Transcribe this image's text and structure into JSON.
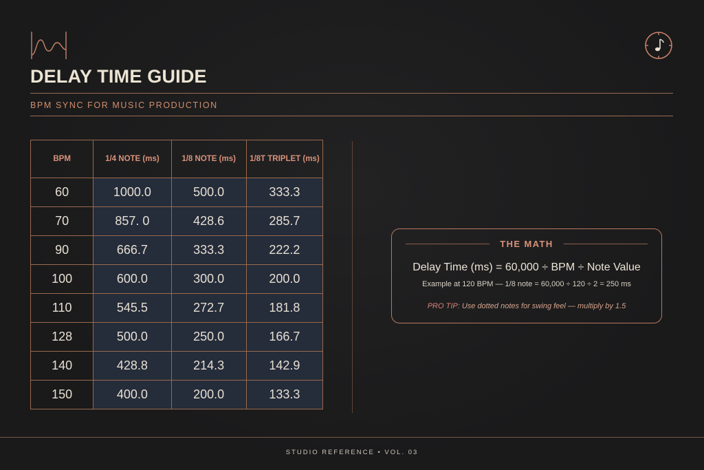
{
  "header": {
    "title": "DELAY TIME GUIDE",
    "subtitle": "BPM SYNC FOR MUSIC PRODUCTION"
  },
  "icons": {
    "logo": "waveform-logo-icon",
    "corner": "clock-music-note-icon"
  },
  "table": {
    "headers": [
      "BPM",
      "1/4 NOTE (ms)",
      "1/8 NOTE (ms)",
      "1/8T TRIPLET (ms)"
    ],
    "rows": [
      [
        "60",
        "1000.0",
        "500.0",
        "333.3"
      ],
      [
        "70",
        "857. 0",
        "428.6",
        "285.7"
      ],
      [
        "90",
        "666.7",
        "333.3",
        "222.2"
      ],
      [
        "100",
        "600.0",
        "300.0",
        "200.0"
      ],
      [
        "110",
        "545.5",
        "272.7",
        "181.8"
      ],
      [
        "128",
        "500.0",
        "250.0",
        "166.7"
      ],
      [
        "140",
        "428.8",
        "214.3",
        "142.9"
      ],
      [
        "150",
        "400.0",
        "200.0",
        "133.3"
      ]
    ]
  },
  "math": {
    "heading": "THE MATH",
    "formula": "Delay Time (ms) = 60,000 ÷ BPM ÷ Note Value",
    "example": "Example at 120 BPM — 1/8 note = 60,000 ÷ 120 ÷ 2 = 250 ms",
    "tip_label": "PRO TIP:",
    "tip_text": " Use dotted notes for swing feel — multiply by 1.5"
  },
  "footer": {
    "text": "STUDIO REFERENCE • VOL. 03"
  },
  "colors": {
    "background": "#1a1a1b",
    "accent": "#d9927a",
    "rule": "#9a6a4e",
    "cell_fill": "#252c3a",
    "title": "#ece4d3"
  }
}
